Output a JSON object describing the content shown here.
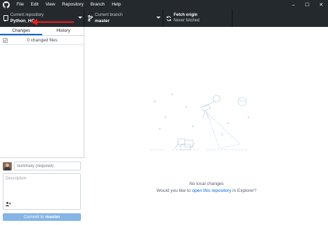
{
  "menu": [
    "File",
    "Edit",
    "View",
    "Repository",
    "Branch",
    "Help"
  ],
  "window_controls": {
    "minimize": "–",
    "maximize": "☐",
    "close": "✕"
  },
  "toolbar": {
    "repository": {
      "label": "Current repository",
      "value": "Python_HC"
    },
    "branch": {
      "label": "Current branch",
      "value": "master"
    },
    "fetch": {
      "label": "Fetch origin",
      "value": "Never fetched"
    }
  },
  "sidebar": {
    "tabs": [
      "Changes",
      "History"
    ],
    "changed_files": "0 changed files",
    "summary_placeholder": "Summary (required)",
    "description_placeholder": "Description",
    "coauthor_icon": "person-add-icon",
    "commit_prefix": "Commit to ",
    "commit_branch": "master"
  },
  "main": {
    "no_changes": "No local changes",
    "hint_prefix": "Would you like to ",
    "hint_link": "open this repository",
    "hint_suffix": " in Explorer?"
  },
  "colors": {
    "titlebar": "#24292e",
    "annotation_arrow": "#e02020",
    "accent": "#0366d6",
    "commit_button": "#84b5e6"
  }
}
